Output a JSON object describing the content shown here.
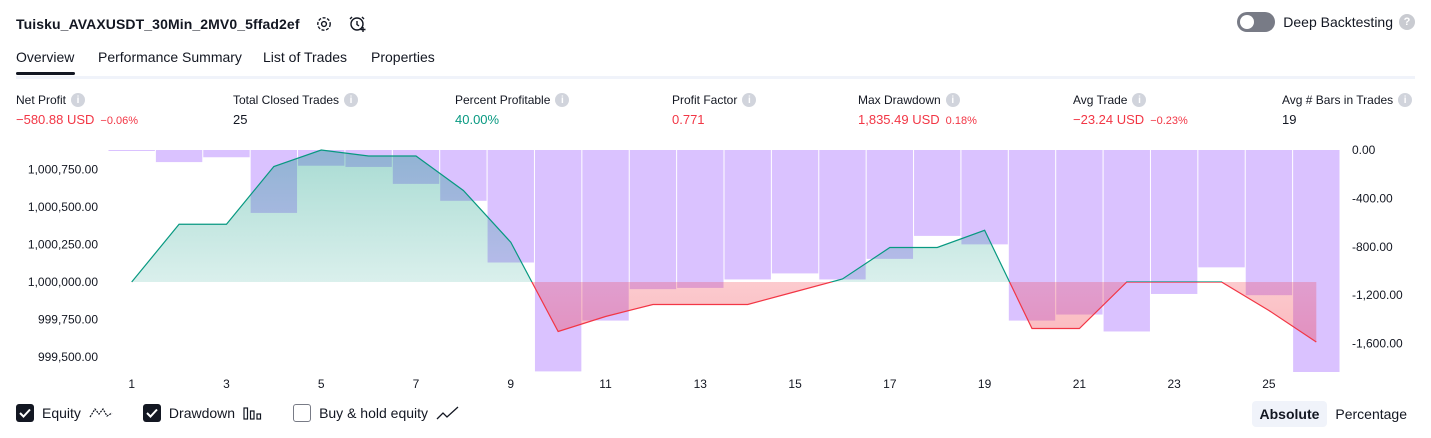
{
  "header": {
    "title": "Tuisku_AVAXUSDT_30Min_2MV0_5ffad2ef",
    "deep_backtesting_label": "Deep Backtesting",
    "help_glyph": "?"
  },
  "tabs": [
    "Overview",
    "Performance Summary",
    "List of Trades",
    "Properties"
  ],
  "metrics": [
    {
      "label": "Net Profit",
      "value": "−580.88 USD",
      "pct": "−0.06%",
      "color": "red"
    },
    {
      "label": "Total Closed Trades",
      "value": "25",
      "pct": "",
      "color": "dark"
    },
    {
      "label": "Percent Profitable",
      "value": "40.00%",
      "pct": "",
      "color": "green"
    },
    {
      "label": "Profit Factor",
      "value": "0.771",
      "pct": "",
      "color": "red"
    },
    {
      "label": "Max Drawdown",
      "value": "1,835.49 USD",
      "pct": "0.18%",
      "color": "red"
    },
    {
      "label": "Avg Trade",
      "value": "−23.24 USD",
      "pct": "−0.23%",
      "color": "red"
    },
    {
      "label": "Avg # Bars in Trades",
      "value": "19",
      "pct": "",
      "color": "dark"
    }
  ],
  "chart_data": {
    "type": "line",
    "x_ticks": [
      1,
      3,
      5,
      7,
      9,
      11,
      13,
      15,
      17,
      19,
      21,
      23,
      25
    ],
    "left_axis_ticks": [
      "1,000,750.00",
      "1,000,500.00",
      "1,000,250.00",
      "1,000,000.00",
      "999,750.00",
      "999,500.00"
    ],
    "right_axis_ticks": [
      "0.00",
      "-400.00",
      "-800.00",
      "-1,200.00",
      "-1,600.00"
    ],
    "left_ylim": [
      999400,
      1000880
    ],
    "right_ylim": [
      -1835,
      0
    ],
    "baseline": 1000000,
    "equity": {
      "x": [
        1,
        2,
        3,
        4,
        5,
        6,
        7,
        8,
        9,
        10,
        11,
        12,
        13,
        14,
        15,
        16,
        17,
        18,
        19,
        20,
        21,
        22,
        23,
        24,
        25,
        26
      ],
      "y": [
        1000000,
        1000385,
        1000385,
        1000770,
        1000880,
        1000840,
        1000840,
        1000610,
        1000265,
        999670,
        999770,
        999850,
        999850,
        999850,
        999935,
        1000020,
        1000230,
        1000230,
        1000345,
        999690,
        999690,
        1000000,
        1000000,
        1000000,
        999810,
        999600
      ]
    },
    "drawdown": {
      "x": [
        1,
        2,
        3,
        4,
        5,
        6,
        7,
        8,
        9,
        10,
        11,
        12,
        13,
        14,
        15,
        16,
        17,
        18,
        19,
        20,
        21,
        22,
        23,
        24,
        25,
        26
      ],
      "values": [
        0,
        -100,
        -60,
        -520,
        -130,
        -140,
        -280,
        -420,
        -930,
        -1830,
        -1410,
        -1150,
        -1140,
        -1070,
        -1020,
        -1070,
        -900,
        -710,
        -780,
        -1410,
        -1360,
        -1500,
        -1190,
        -970,
        -1200,
        -1835
      ]
    },
    "grid": false,
    "colors": {
      "equity_up": "#089981",
      "equity_down": "#f23645",
      "drawdown": "#d1b3ff"
    }
  },
  "legend": {
    "equity": "Equity",
    "drawdown": "Drawdown",
    "buyhold": "Buy & hold equity"
  },
  "segments": {
    "absolute": "Absolute",
    "percentage": "Percentage"
  }
}
